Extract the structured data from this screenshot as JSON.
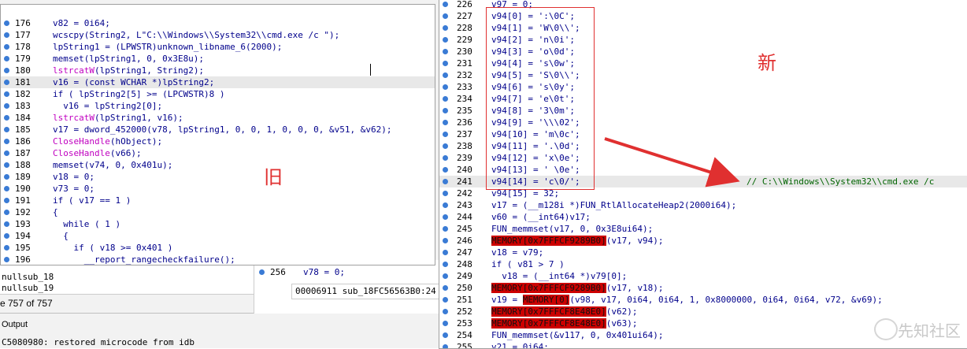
{
  "left_code": {
    "lines": [
      {
        "n": "176",
        "t": "v82 = 0i64;"
      },
      {
        "n": "177",
        "t": "wcscpy(String2, L\"C:\\\\Windows\\\\System32\\\\cmd.exe /c \");"
      },
      {
        "n": "178",
        "t": "lpString1 = (LPWSTR)unknown_libname_6(2000);"
      },
      {
        "n": "179",
        "t": "memset(lpString1, 0, 0x3E8u);"
      },
      {
        "n": "180",
        "t": "lstrcatW(lpString1, String2);"
      },
      {
        "n": "181",
        "t": "v16 = (const WCHAR *)lpString2;"
      },
      {
        "n": "182",
        "t": "if ( lpString2[5] >= (LPCWSTR)8 )"
      },
      {
        "n": "183",
        "t": "  v16 = lpString2[0];"
      },
      {
        "n": "184",
        "t": "lstrcatW(lpString1, v16);"
      },
      {
        "n": "185",
        "t": "v17 = dword_452000(v78, lpString1, 0, 0, 1, 0, 0, 0, &v51, &v62);"
      },
      {
        "n": "186",
        "t": "CloseHandle(hObject);"
      },
      {
        "n": "187",
        "t": "CloseHandle(v66);"
      },
      {
        "n": "188",
        "t": "memset(v74, 0, 0x401u);"
      },
      {
        "n": "189",
        "t": "v18 = 0;"
      },
      {
        "n": "190",
        "t": "v73 = 0;"
      },
      {
        "n": "191",
        "t": "if ( v17 == 1 )"
      },
      {
        "n": "192",
        "t": "{"
      },
      {
        "n": "193",
        "t": "  while ( 1 )"
      },
      {
        "n": "194",
        "t": "  {"
      },
      {
        "n": "195",
        "t": "    if ( v18 >= 0x401 )"
      },
      {
        "n": "196",
        "t": "      __report_rangecheckfailure();"
      }
    ]
  },
  "right_code": {
    "lines": [
      {
        "n": "226",
        "t": "v97 = 0;"
      },
      {
        "n": "227",
        "t": "v94[0] = ':\\0C';"
      },
      {
        "n": "228",
        "t": "v94[1] = 'W\\0\\\\';"
      },
      {
        "n": "229",
        "t": "v94[2] = 'n\\0i';"
      },
      {
        "n": "230",
        "t": "v94[3] = 'o\\0d';"
      },
      {
        "n": "231",
        "t": "v94[4] = 's\\0w';"
      },
      {
        "n": "232",
        "t": "v94[5] = 'S\\0\\\\';"
      },
      {
        "n": "233",
        "t": "v94[6] = 's\\0y';"
      },
      {
        "n": "234",
        "t": "v94[7] = 'e\\0t';"
      },
      {
        "n": "235",
        "t": "v94[8] = '3\\0m';"
      },
      {
        "n": "236",
        "t": "v94[9] = '\\\\\\02';"
      },
      {
        "n": "237",
        "t": "v94[10] = 'm\\0c';"
      },
      {
        "n": "238",
        "t": "v94[11] = '.\\0d';"
      },
      {
        "n": "239",
        "t": "v94[12] = 'x\\0e';"
      },
      {
        "n": "240",
        "t": "v94[13] = ' \\0e';"
      },
      {
        "n": "241",
        "t": "v94[14] = 'c\\0/';"
      },
      {
        "n": "242",
        "t": "v94[15] = 32;"
      },
      {
        "n": "243",
        "t": "v17 = (__m128i *)FUN_RtlAllocateHeap2(2000i64);"
      },
      {
        "n": "244",
        "t": "v60 = (__int64)v17;"
      },
      {
        "n": "245",
        "t": "FUN_memmset(v17, 0, 0x3E8ui64);"
      },
      {
        "n": "246",
        "t": "MEMORY[0x7FFFCF9289B0](v17, v94);"
      },
      {
        "n": "247",
        "t": "v18 = v79;"
      },
      {
        "n": "248",
        "t": "if ( v81 > 7 )"
      },
      {
        "n": "249",
        "t": "  v18 = (__int64 *)v79[0];"
      },
      {
        "n": "250",
        "t": "MEMORY[0x7FFFCF9289B0](v17, v18);"
      },
      {
        "n": "251",
        "t": "v19 = MEMORY[0](v98, v17, 0i64, 0i64, 1, 0x8000000, 0i64, 0i64, v72, &v69);"
      },
      {
        "n": "252",
        "t": "MEMORY[0x7FFFCF8E48E0](v62);"
      },
      {
        "n": "253",
        "t": "MEMORY[0x7FFFCF8E48E0](v63);"
      },
      {
        "n": "254",
        "t": "FUN_memmset(&v117, 0, 0x401ui64);"
      },
      {
        "n": "255",
        "t": "v21 = 0i64;"
      }
    ],
    "comment_241": "// C:\\\\Windows\\\\System32\\\\cmd.exe /c"
  },
  "annotations": {
    "old": "旧",
    "new": "新"
  },
  "background": {
    "list_items": [
      "nullsub_18",
      "nullsub_19"
    ],
    "line_count": "e 757 of 757",
    "output_label": "Output",
    "log_line": "C5080980: restored microcode from idb",
    "mid_line_num": "256",
    "mid_code": "v78 = 0;",
    "status_text": "00006911 sub_18FC56563B0:24"
  },
  "watermark": "先知社区",
  "colors": {
    "accent_red": "#e03030",
    "memory_highlight": "#cc0000",
    "code_blue": "#00008b",
    "func_magenta": "#c000c0"
  }
}
